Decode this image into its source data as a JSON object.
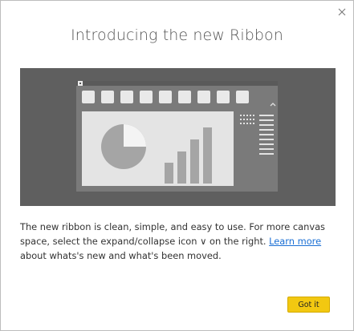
{
  "dialog": {
    "close_icon": "close-icon",
    "title": "Introducing the new Ribbon",
    "description_part1": "The new ribbon is clean, simple, and easy to use. For more canvas space, select the expand/collapse icon ",
    "collapse_glyph": "∨",
    "description_part2": " on the right. ",
    "learn_more_link": "Learn more",
    "description_part3": " about whats's new and what's been moved.",
    "got_it_label": "Got it"
  },
  "colors": {
    "hero_background": "#5f5f5f",
    "accent_button": "#f2c811",
    "link": "#1a6fd4"
  }
}
